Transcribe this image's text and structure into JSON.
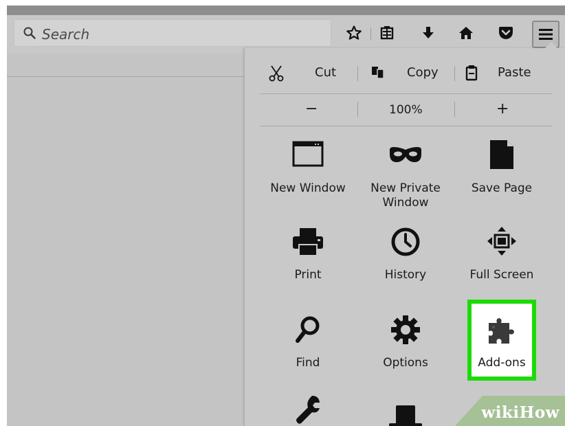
{
  "toolbar": {
    "search_placeholder": "Search",
    "icons": [
      "bookmark-star-icon",
      "reading-list-icon",
      "downloads-icon",
      "home-icon",
      "pocket-icon",
      "hamburger-menu-icon"
    ]
  },
  "edit_row": {
    "cut": "Cut",
    "copy": "Copy",
    "paste": "Paste"
  },
  "zoom_row": {
    "minus": "−",
    "level": "100%",
    "plus": "+"
  },
  "tiles": [
    {
      "label": "New Window",
      "icon": "window-icon"
    },
    {
      "label": "New Private Window",
      "icon": "mask-icon"
    },
    {
      "label": "Save Page",
      "icon": "page-icon"
    },
    {
      "label": "Print",
      "icon": "printer-icon"
    },
    {
      "label": "History",
      "icon": "clock-icon"
    },
    {
      "label": "Full Screen",
      "icon": "fullscreen-icon"
    },
    {
      "label": "Find",
      "icon": "magnifier-icon"
    },
    {
      "label": "Options",
      "icon": "gear-icon"
    },
    {
      "label": "Add-ons",
      "icon": "puzzle-icon"
    },
    {
      "label": "",
      "icon": "wrench-icon"
    },
    {
      "label": "",
      "icon": "hat-icon"
    }
  ],
  "highlight_color": "#1cdb07",
  "watermark": "wikiHow"
}
